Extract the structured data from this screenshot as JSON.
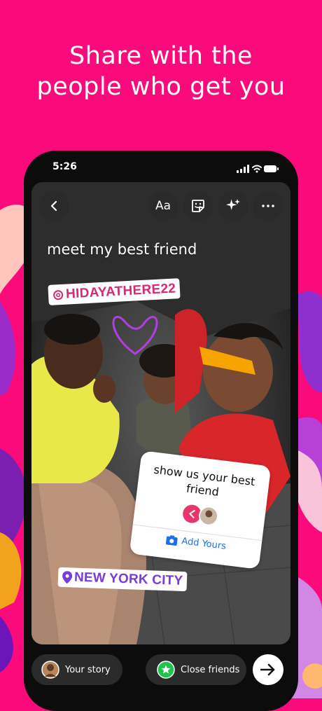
{
  "headline": {
    "line1": "Share with the",
    "line2": "people who get you"
  },
  "status_bar": {
    "time": "5:26"
  },
  "story_toolbar": {
    "text_tool_label": "Aa",
    "icons": [
      "back-chevron-icon",
      "sticker-icon",
      "sparkles-effects-icon",
      "more-options-icon"
    ]
  },
  "story": {
    "caption": "meet my best friend",
    "mention": "HIDAYATHERE22",
    "add_yours": {
      "prompt": "show us your best friend",
      "action_label": "Add Yours"
    },
    "location": "NEW YORK CITY"
  },
  "share_bar": {
    "your_story_label": "Your story",
    "close_friends_label": "Close friends"
  },
  "colors": {
    "background": "#fb0a7c",
    "mention_text": "#d62976",
    "location_text": "#7a3cd6",
    "add_yours_action": "#1d6fe8",
    "close_friends_badge": "#1fc44e"
  }
}
